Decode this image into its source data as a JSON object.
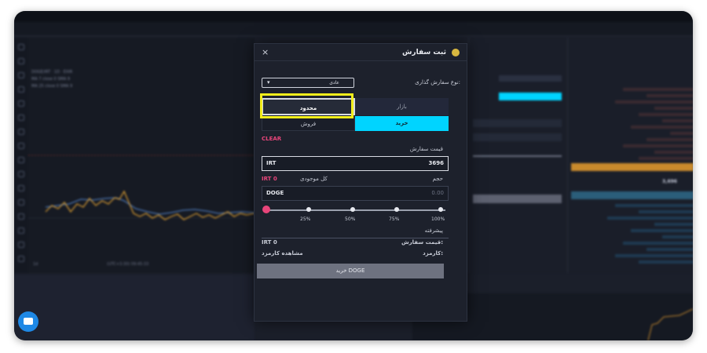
{
  "modal": {
    "title": "ثبت سفارش",
    "close_icon": "×",
    "order_type_label": "نوع سفارش گذاری:",
    "order_type_value": "عادی",
    "tabs_order_kind": [
      "بازار",
      "محدود"
    ],
    "tabs_side": [
      "خرید",
      "فروش"
    ],
    "clear_label": "CLEAR",
    "price_label": "قیمت سفارش",
    "price_currency": "IRT",
    "price_value": "3696",
    "volume_label": "حجم",
    "balance_label": "کل موجودی",
    "balance_value": "IRT 0",
    "volume_currency": "DOGE",
    "volume_placeholder": "0.00",
    "slider_marks": [
      "25%",
      "50%",
      "75%",
      "100%"
    ],
    "advanced_label": "پیشرفته",
    "order_price_label": "قیمت سفارش:",
    "order_price_value": "IRT 0",
    "fee_label": "کارمزد:",
    "fee_value": "مشاهده کارمزد",
    "submit_label": "خرید DOGE"
  },
  "background": {
    "chart_footer_left": "1d",
    "chart_footer_time": "(UTC+3:30) 09:45:33",
    "chart_legend": [
      "DOGE/IRT · 1D · EXIR",
      "MA 7 close 0 SMA 9",
      "MA 25 close 0 SMA 9"
    ],
    "orderbook_price": "3,696",
    "colors": {
      "buy": "#00d4ff",
      "sell": "#e8457a",
      "highlight": "#f3ee1b",
      "orange": "#f0a030"
    }
  }
}
